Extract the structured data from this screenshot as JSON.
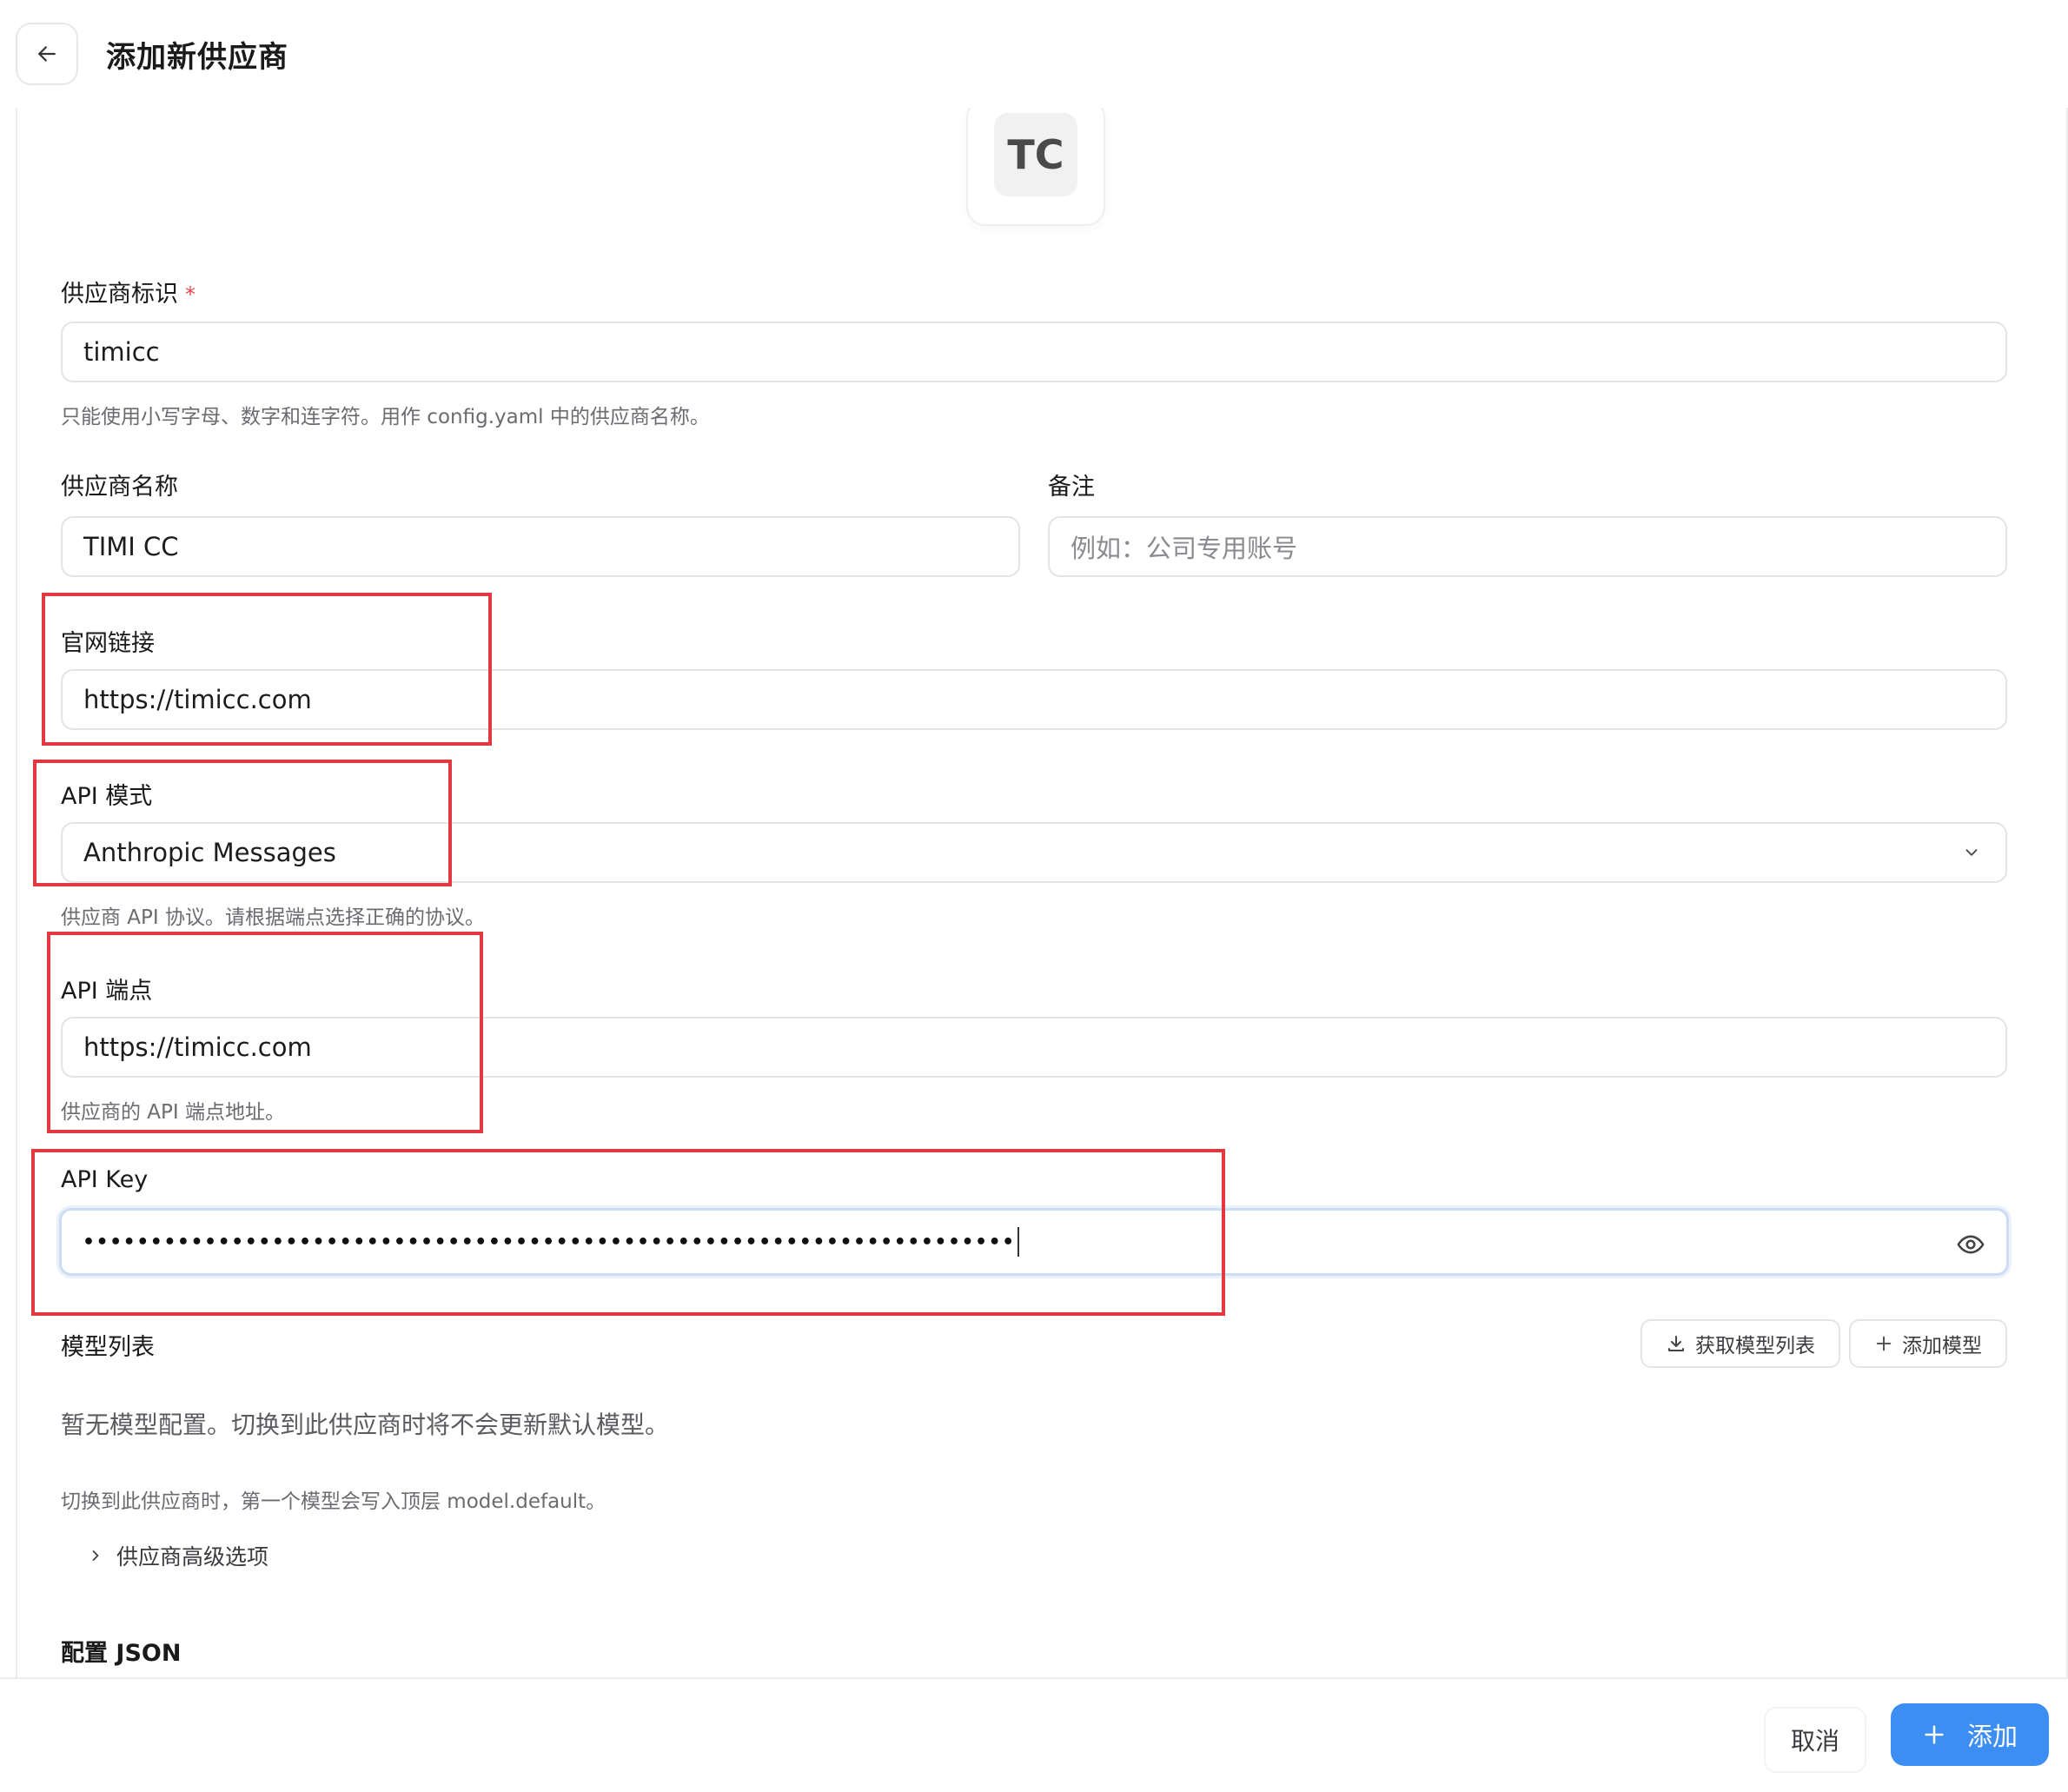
{
  "header": {
    "title": "添加新供应商"
  },
  "avatar": {
    "initials": "TC"
  },
  "fields": {
    "provider_id": {
      "label": "供应商标识",
      "required_mark": "*",
      "value": "timicc",
      "help": "只能使用小写字母、数字和连字符。用作 config.yaml 中的供应商名称。"
    },
    "provider_name": {
      "label": "供应商名称",
      "value": "TIMI CC"
    },
    "note": {
      "label": "备注",
      "placeholder": "例如：公司专用账号"
    },
    "website": {
      "label": "官网链接",
      "value": "https://timicc.com"
    },
    "api_mode": {
      "label": "API 模式",
      "selected": "Anthropic Messages",
      "help": "供应商 API 协议。请根据端点选择正确的协议。"
    },
    "api_endpoint": {
      "label": "API 端点",
      "value": "https://timicc.com",
      "help": "供应商的 API 端点地址。"
    },
    "api_key": {
      "label": "API Key",
      "masked_value": "•••••••••••••••••••••••••••••••••••••••••••••••••••••••••••••••••••••"
    }
  },
  "models": {
    "title": "模型列表",
    "fetch_button": "获取模型列表",
    "add_button": "添加模型",
    "empty_text": "暂无模型配置。切换到此供应商时将不会更新默认模型。",
    "help": "切换到此供应商时，第一个模型会写入顶层 model.default。"
  },
  "advanced": {
    "label": "供应商高级选项"
  },
  "config_json": {
    "title": "配置 JSON"
  },
  "footer": {
    "cancel": "取消",
    "add": "添加"
  },
  "colors": {
    "primary": "#3d8ef2",
    "highlight_box": "#e0393e",
    "required": "#e5484d"
  },
  "icons": {
    "back": "arrow-left-icon",
    "select": "chevron-down-icon",
    "visibility": "eye-icon",
    "fetch": "download-icon",
    "add_model": "plus-icon",
    "advanced": "chevron-right-icon",
    "add": "plus-icon"
  }
}
